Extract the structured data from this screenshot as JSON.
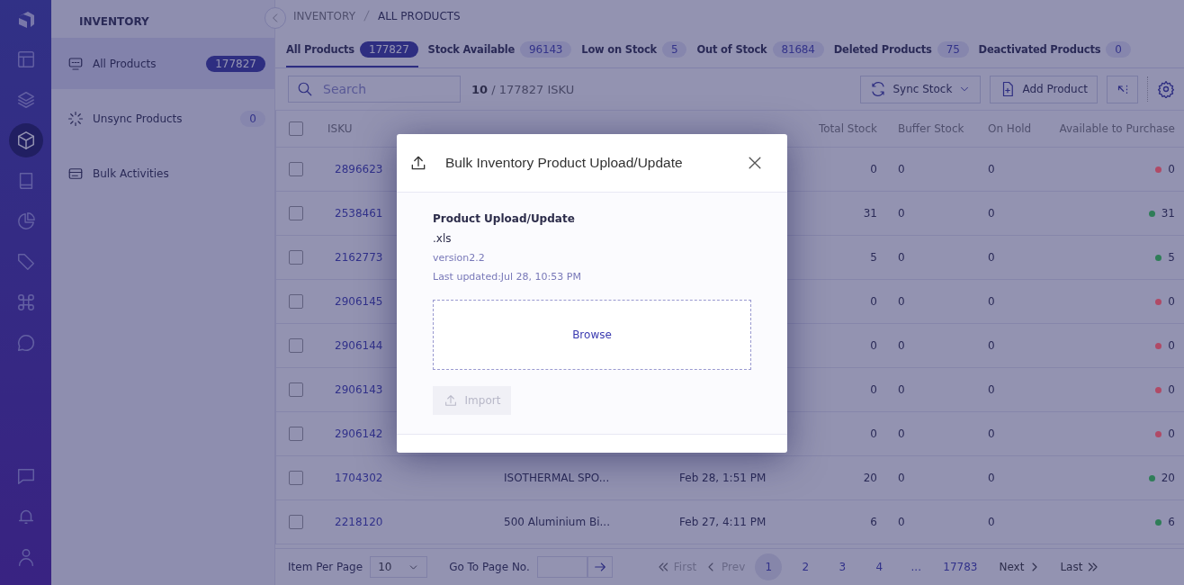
{
  "rail": {
    "items": [
      {
        "selected": false
      },
      {
        "selected": false
      },
      {
        "selected": true
      },
      {
        "selected": false
      },
      {
        "selected": false
      },
      {
        "selected": false
      },
      {
        "selected": false
      },
      {
        "selected": false
      }
    ]
  },
  "sidebar": {
    "title": "INVENTORY",
    "items": [
      {
        "label": "All Products",
        "count": "177827",
        "selected": true
      },
      {
        "label": "Unsync Products",
        "count": "0",
        "selected": false
      },
      {
        "label": "Bulk Activities",
        "selected": false
      }
    ]
  },
  "breadcrumb": [
    "INVENTORY",
    "ALL PRODUCTS"
  ],
  "tabs": [
    {
      "label": "All Products",
      "count": "177827",
      "selected": true
    },
    {
      "label": "Stock Available",
      "count": "96143",
      "selected": false
    },
    {
      "label": "Low on Stock",
      "count": "5",
      "selected": false
    },
    {
      "label": "Out of Stock",
      "count": "81684",
      "selected": false
    },
    {
      "label": "Deleted Products",
      "count": "75",
      "selected": false
    },
    {
      "label": "Deactivated Products",
      "count": "0",
      "selected": false
    }
  ],
  "toolbar": {
    "search_placeholder": "Search",
    "shown": "10",
    "total": "/ 177827 ISKU",
    "sync_button": "Sync Stock",
    "add_button": "Add Product"
  },
  "table": {
    "all_selected": false,
    "columns": [
      "ISKU",
      "Total Stock",
      "Buffer Stock",
      "On Hold",
      "Available to Purchase"
    ],
    "rows": [
      {
        "checked": false,
        "isku": "2896623",
        "total": "0",
        "buffer": "0",
        "hold": "0",
        "available": "0",
        "color": "#b04a66"
      },
      {
        "checked": false,
        "isku": "2538461",
        "total": "31",
        "buffer": "0",
        "hold": "0",
        "available": "31",
        "color": "#2f7d58"
      },
      {
        "checked": false,
        "isku": "2162773",
        "total": "5",
        "buffer": "0",
        "hold": "0",
        "available": "5",
        "color": "#2f7d58"
      },
      {
        "checked": false,
        "isku": "2906145",
        "total": "0",
        "buffer": "0",
        "hold": "0",
        "available": "0",
        "color": "#b04a66"
      },
      {
        "checked": false,
        "isku": "2906144",
        "total": "0",
        "buffer": "0",
        "hold": "0",
        "available": "0",
        "color": "#b04a66"
      },
      {
        "checked": false,
        "isku": "2906143",
        "total": "0",
        "buffer": "0",
        "hold": "0",
        "available": "0",
        "color": "#b04a66"
      },
      {
        "checked": false,
        "isku": "2906142",
        "total": "0",
        "buffer": "0",
        "hold": "0",
        "available": "0",
        "color": "#b04a66"
      },
      {
        "checked": false,
        "isku": "1704302",
        "name": "ISOTHERMAL SPO...",
        "updated": "Feb 28, 1:51 PM",
        "total": "20",
        "buffer": "0",
        "hold": "0",
        "available": "20",
        "color": "#2f7d58"
      },
      {
        "checked": false,
        "isku": "2218120",
        "name": "500 Aluminium Bi...",
        "updated": "Feb 27, 4:11 PM",
        "total": "6",
        "buffer": "0",
        "hold": "0",
        "available": "6",
        "color": "#2f7d58"
      }
    ]
  },
  "footer": {
    "per_page_label": "Item Per Page",
    "per_page": "10",
    "goto_label": "Go To Page No.",
    "first": "First",
    "prev": "Prev",
    "pages": [
      {
        "label": "1",
        "selected": true
      },
      {
        "label": "2",
        "selected": false
      },
      {
        "label": "3",
        "selected": false
      },
      {
        "label": "4",
        "selected": false
      },
      {
        "label": "...",
        "selected": false
      },
      {
        "label": "17783",
        "selected": false
      }
    ],
    "next": "Next",
    "last": "Last"
  },
  "modal": {
    "title": "Bulk Inventory Product Upload/Update",
    "heading": "Product Upload/Update",
    "format": ".xls",
    "version": "version2.2",
    "last_updated": "Last updated:Jul 28, 10:53 PM",
    "browse": "Browse",
    "import": "Import",
    "import_disabled": true
  }
}
